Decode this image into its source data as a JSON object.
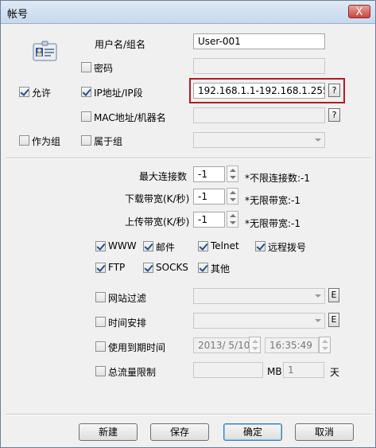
{
  "window": {
    "title": "帐号",
    "close_label": "X"
  },
  "account": {
    "username_label": "用户名/组名",
    "username_value": "User-001",
    "password_label": "密码",
    "allow_label": "允许",
    "ip_label": "IP地址/IP段",
    "ip_value": "192.168.1.1-192.168.1.255",
    "mac_label": "MAC地址/机器名",
    "as_group_label": "作为组",
    "belongs_group_label": "属于组",
    "help_label": "?"
  },
  "limits": {
    "max_conn_label": "最大连接数",
    "max_conn_value": "-1",
    "max_conn_hint": "*不限连接数:-1",
    "download_label": "下载带宽(K/秒)",
    "download_value": "-1",
    "download_hint": "*无限带宽:-1",
    "upload_label": "上传带宽(K/秒)",
    "upload_value": "-1",
    "upload_hint": "*无限带宽:-1"
  },
  "protocols": {
    "www": "WWW",
    "mail": "邮件",
    "telnet": "Telnet",
    "remote": "远程拨号",
    "ftp": "FTP",
    "socks": "SOCKS",
    "other": "其他"
  },
  "filters": {
    "site_filter_label": "网站过滤",
    "schedule_label": "时间安排",
    "expire_label": "使用到期时间",
    "expire_date": "2013/ 5/10",
    "expire_time": "16:35:49",
    "traffic_label": "总流量限制",
    "traffic_unit": "MB",
    "traffic_days": "1",
    "days_unit": "天",
    "edit_label": "E"
  },
  "buttons": {
    "new": "新建",
    "save": "保存",
    "ok": "确定",
    "cancel": "取消"
  }
}
